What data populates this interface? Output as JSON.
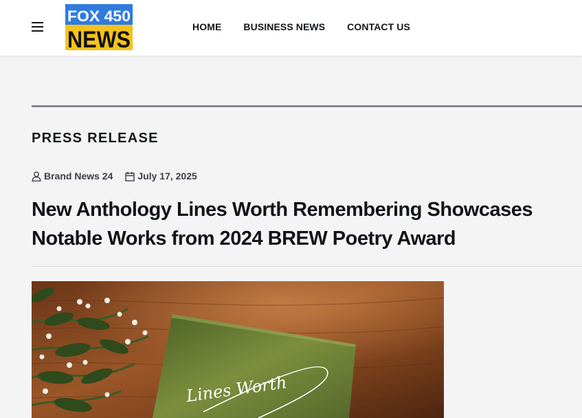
{
  "header": {
    "logo": {
      "line1": "FOX 450",
      "line2": "NEWS"
    },
    "nav": [
      {
        "label": "HOME"
      },
      {
        "label": "BUSINESS NEWS"
      },
      {
        "label": "CONTACT US"
      }
    ]
  },
  "article": {
    "category": "PRESS RELEASE",
    "author": "Brand News 24",
    "date": "July 17, 2025",
    "title": "New Anthology Lines Worth Remembering Showcases Notable Works from 2024 BREW Poetry Award",
    "image": {
      "cover_text": "Lines Worth"
    }
  },
  "colors": {
    "logo_blue": "#1b5fbd",
    "logo_yellow": "#f4c319",
    "divider": "#828690",
    "background": "#f4f4f5"
  },
  "icons": [
    "menu-icon",
    "user-icon",
    "calendar-icon"
  ]
}
